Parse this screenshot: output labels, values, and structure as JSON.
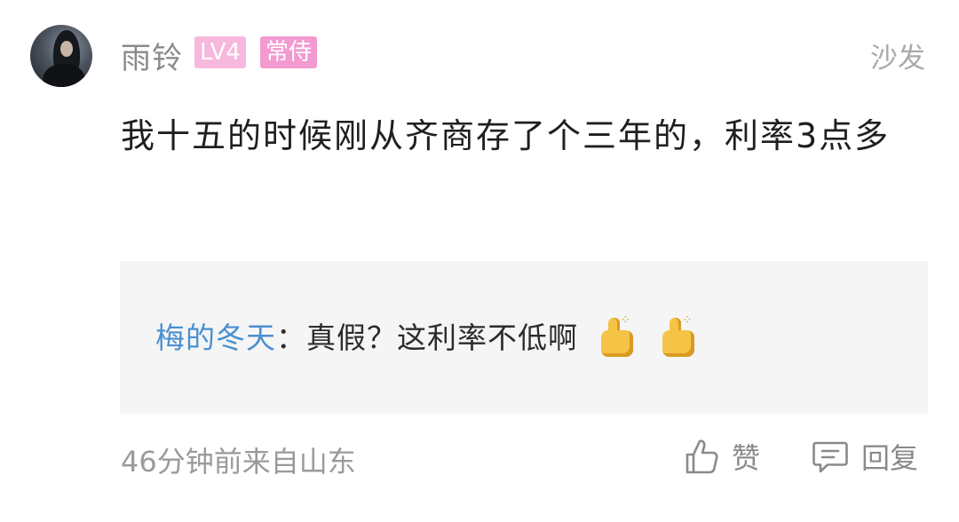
{
  "comment": {
    "username": "雨铃",
    "level_badge": "LV4",
    "title_badge": "常侍",
    "sofa_label": "沙发",
    "text": "我十五的时候刚从齐商存了个三年的，利率3点多"
  },
  "reply": {
    "author": "梅的冬天",
    "separator": "：",
    "text": "真假？这利率不低啊",
    "emojis": [
      "thumbs-up-icon",
      "thumbs-up-icon"
    ]
  },
  "footer": {
    "meta": "46分钟前来自山东",
    "like_label": "赞",
    "reply_label": "回复"
  },
  "colors": {
    "level_badge_bg": "#f7b8dd",
    "title_badge_bg": "#f39ad0",
    "reply_author": "#4a90d0",
    "reply_box_bg": "#f5f5f5"
  }
}
